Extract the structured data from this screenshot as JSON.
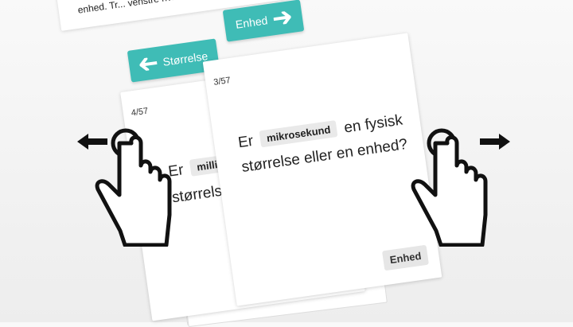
{
  "instructions": {
    "text": "enhed. Tr... venstre hvis det er en e..."
  },
  "buttons": {
    "left_label": "Størrelse",
    "right_label": "Enhed"
  },
  "back_card": {
    "counter": "4/57",
    "question_prefix": "Er",
    "term": "milliseku",
    "question_suffix": "størrelse ell"
  },
  "front_card": {
    "counter": "3/57",
    "question_prefix": "Er",
    "term": "mikrosekund",
    "question_mid": "en fysisk",
    "question_line2": "størrelse eller en enhed?",
    "answer_label": "Enhed"
  },
  "icons": {
    "left": "swipe-left-hand-icon",
    "right": "swipe-right-hand-icon",
    "arrow_left": "arrow-left-icon",
    "arrow_right": "arrow-right-icon"
  },
  "colors": {
    "accent": "#3fbcb6"
  }
}
